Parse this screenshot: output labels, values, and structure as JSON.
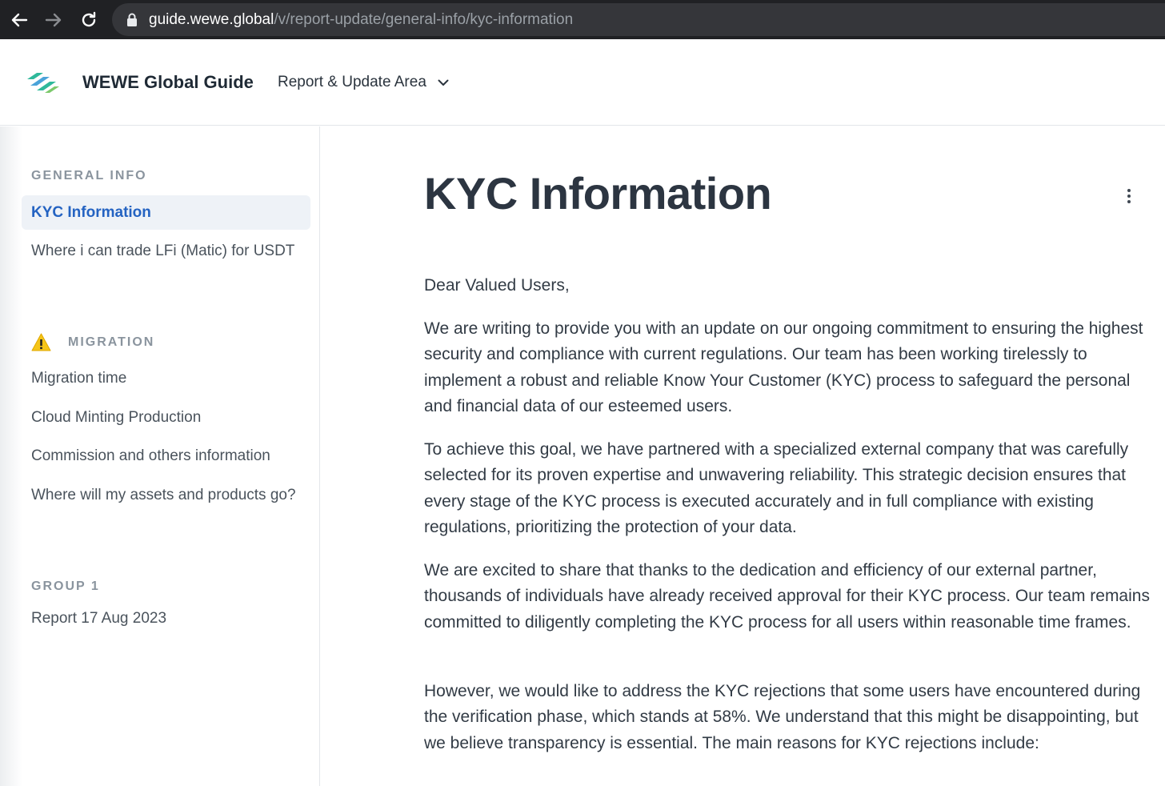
{
  "browser": {
    "url_host": "guide.wewe.global",
    "url_path": "/v/report-update/general-info/kyc-information"
  },
  "header": {
    "site_title": "WEWE Global Guide",
    "space_label": "Report & Update Area"
  },
  "sidebar": {
    "groups": [
      {
        "title": "GENERAL INFO",
        "items": [
          {
            "label": "KYC Information",
            "active": true
          },
          {
            "label": "Where i can trade LFi (Matic) for USDT"
          }
        ]
      },
      {
        "title": "MIGRATION",
        "icon": "warning-icon",
        "items": [
          {
            "label": "Migration time"
          },
          {
            "label": "Cloud Minting Production"
          },
          {
            "label": "Commission and others information"
          },
          {
            "label": "Where will my assets and products go?"
          }
        ]
      },
      {
        "title": "GROUP 1",
        "items": [
          {
            "label": "Report 17 Aug 2023"
          }
        ]
      }
    ]
  },
  "main": {
    "title": "KYC Information",
    "paragraphs": [
      "Dear Valued Users,",
      "We are writing to provide you with an update on our ongoing commitment to ensuring the highest security and compliance with current regulations. Our team has been working tirelessly to implement a robust and reliable Know Your Customer (KYC) process to safeguard the personal and financial data of our esteemed users.",
      "To achieve this goal, we have partnered with a specialized external company that was carefully selected for its proven expertise and unwavering reliability. This strategic decision ensures that every stage of the KYC process is executed accurately and in full compliance with existing regulations, prioritizing the protection of your data.",
      "We are excited to share that thanks to the dedication and efficiency of our external partner, thousands of individuals have already received approval for their KYC process. Our team remains committed to diligently completing the KYC process for all users within reasonable time frames.",
      "However, we would like to address the KYC rejections that some users have encountered during the verification phase, which stands at 58%. We understand that this might be disappointing, but we believe transparency is essential. The main reasons for KYC rejections include:"
    ]
  },
  "icons": [
    "back-icon",
    "forward-icon",
    "reload-icon",
    "lock-icon",
    "logo-icon",
    "chevron-down-icon",
    "warning-icon",
    "more-vertical-icon"
  ],
  "colors": {
    "accent": "#2463c2",
    "browser_bar": "#202124",
    "warning": "#f5c518"
  }
}
